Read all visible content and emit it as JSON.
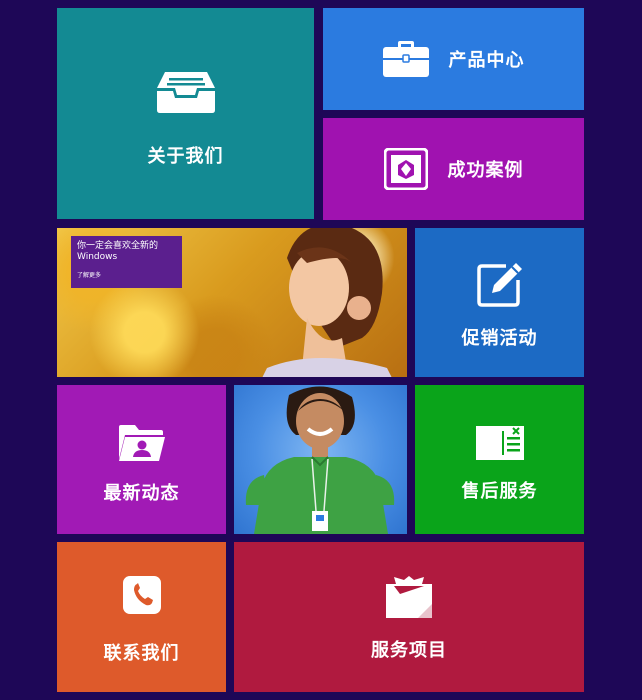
{
  "tiles": {
    "about": {
      "label": "关于我们",
      "icon": "inbox-tray-icon",
      "color": "#138a93"
    },
    "product": {
      "label": "产品中心",
      "icon": "briefcase-icon",
      "color": "#2b7be0"
    },
    "cases": {
      "label": "成功案例",
      "icon": "case-box-icon",
      "color": "#a012b0"
    },
    "promo": {
      "label": "促销活动",
      "icon": "edit-pencil-icon",
      "color": "#1c6ac4"
    },
    "news": {
      "label": "最新动态",
      "icon": "folder-person-icon",
      "color": "#a11ab5"
    },
    "after": {
      "label": "售后服务",
      "icon": "ticket-card-icon",
      "color": "#0aa41a"
    },
    "contact": {
      "label": "联系我们",
      "icon": "phone-icon",
      "color": "#de5a2b"
    },
    "service": {
      "label": "服务项目",
      "icon": "package-box-icon",
      "color": "#b01a3f"
    }
  },
  "banner": {
    "headline": "你一定会喜欢全新的 Windows",
    "more": "了解更多"
  },
  "colors": {
    "background": "#1e0757"
  }
}
